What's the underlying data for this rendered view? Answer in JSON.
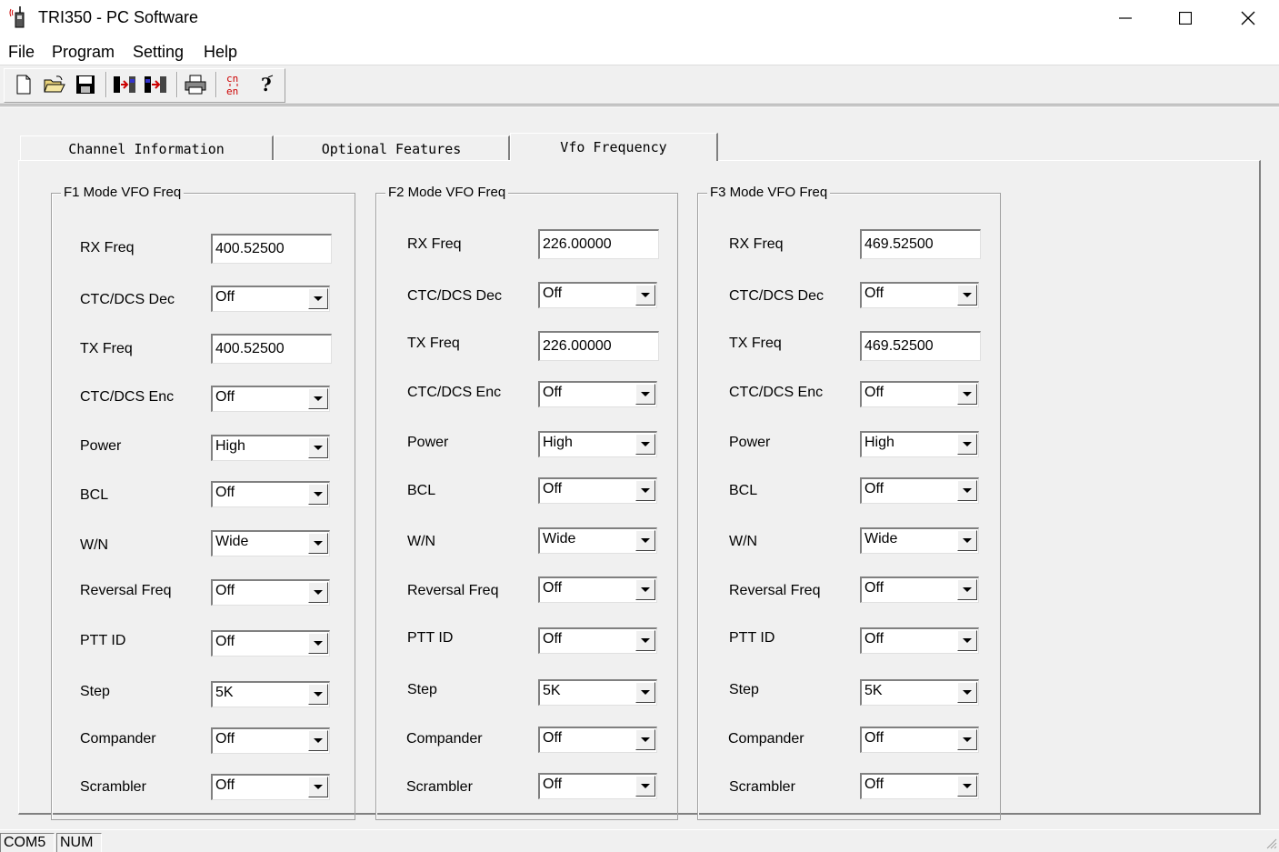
{
  "window": {
    "title": "TRI350 - PC Software",
    "minimize_glyph": "—",
    "maximize_glyph": "☐",
    "close_glyph": "✕"
  },
  "menu": [
    {
      "label": "File"
    },
    {
      "label": "Program"
    },
    {
      "label": "Setting"
    },
    {
      "label": "Help"
    }
  ],
  "toolbar": {
    "buttons": [
      {
        "icon": "new-file-icon"
      },
      {
        "icon": "open-folder-icon"
      },
      {
        "icon": "save-icon"
      },
      {
        "icon": "read-from-radio-icon"
      },
      {
        "icon": "write-to-radio-icon"
      },
      {
        "icon": "print-icon"
      },
      {
        "icon": "language-toggle-icon",
        "text": "cn\nen"
      },
      {
        "icon": "help-icon",
        "text": "?"
      }
    ]
  },
  "tabs": [
    {
      "label": "Channel Information",
      "active": false
    },
    {
      "label": "Optional Features",
      "active": false
    },
    {
      "label": "Vfo Frequency",
      "active": true
    }
  ],
  "labels": {
    "rx_freq": "RX Freq",
    "ctc_dec": "CTC/DCS Dec",
    "tx_freq": "TX Freq",
    "ctc_enc": "CTC/DCS Enc",
    "power": "Power",
    "bcl": "BCL",
    "wn": "W/N",
    "reversal": "Reversal Freq",
    "ptt_id": "PTT ID",
    "step": "Step",
    "compander": "Compander",
    "scrambler": "Scrambler"
  },
  "groups": [
    {
      "title": "F1 Mode VFO Freq",
      "rx_freq": "400.52500",
      "ctc_dec": "Off",
      "tx_freq": "400.52500",
      "ctc_enc": "Off",
      "power": "High",
      "bcl": "Off",
      "wn": "Wide",
      "reversal": "Off",
      "ptt_id": "Off",
      "step": "5K",
      "compander": "Off",
      "scrambler": "Off"
    },
    {
      "title": "F2 Mode VFO Freq",
      "rx_freq": "226.00000",
      "ctc_dec": "Off",
      "tx_freq": "226.00000",
      "ctc_enc": "Off",
      "power": "High",
      "bcl": "Off",
      "wn": "Wide",
      "reversal": "Off",
      "ptt_id": "Off",
      "step": "5K",
      "compander": "Off",
      "scrambler": "Off"
    },
    {
      "title": "F3 Mode VFO Freq",
      "rx_freq": "469.52500",
      "ctc_dec": "Off",
      "tx_freq": "469.52500",
      "ctc_enc": "Off",
      "power": "High",
      "bcl": "Off",
      "wn": "Wide",
      "reversal": "Off",
      "ptt_id": "Off",
      "step": "5K",
      "compander": "Off",
      "scrambler": "Off"
    }
  ],
  "status": {
    "port": "COM5",
    "num": "NUM"
  }
}
